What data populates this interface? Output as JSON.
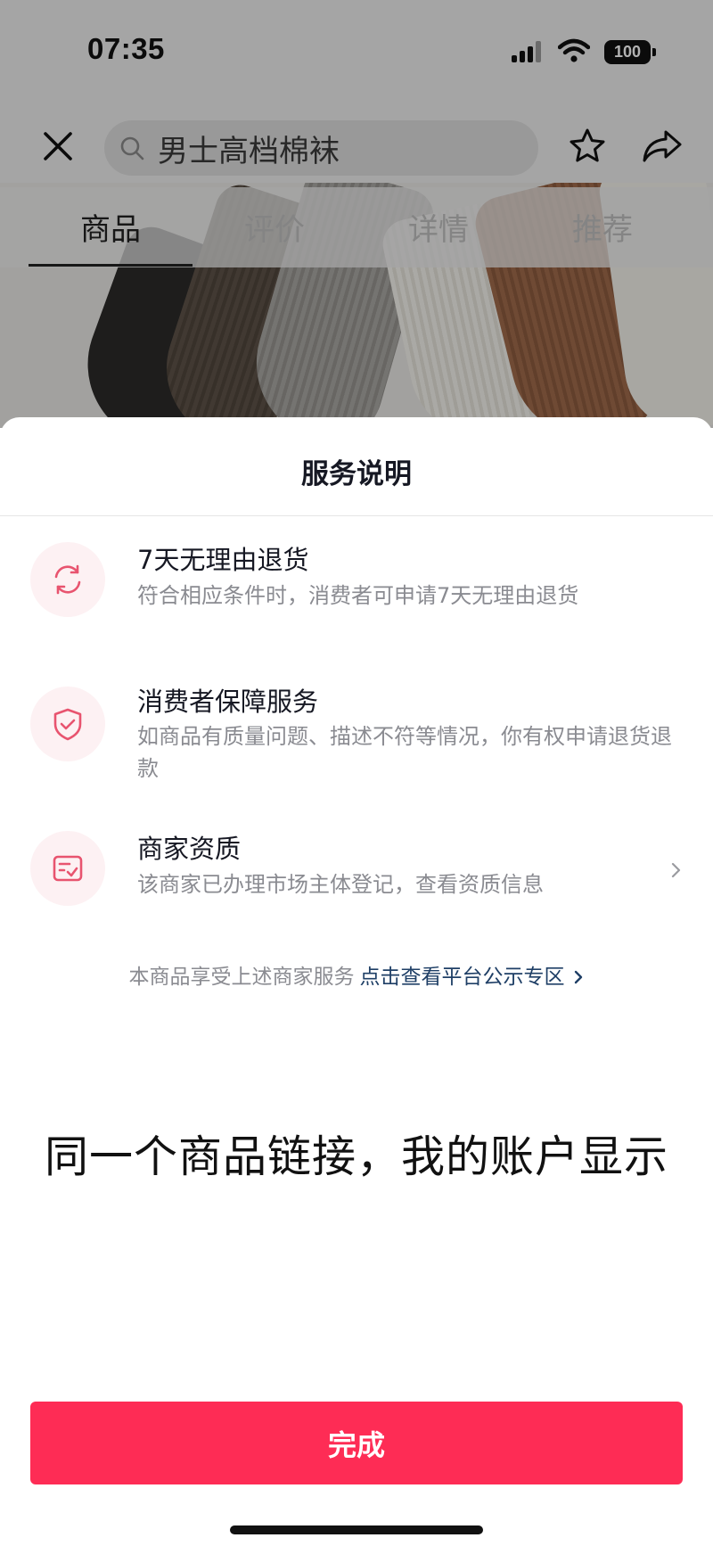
{
  "status_bar": {
    "time": "07:35",
    "battery": "100"
  },
  "top_bar": {
    "search_text": "男士高档棉袜"
  },
  "tabs": [
    {
      "label": "商品",
      "active": true
    },
    {
      "label": "评价",
      "active": false
    },
    {
      "label": "详情",
      "active": false
    },
    {
      "label": "推荐",
      "active": false
    }
  ],
  "sheet": {
    "title": "服务说明",
    "services": [
      {
        "icon": "return-refresh-icon",
        "title": "7天无理由退货",
        "desc": "符合相应条件时，消费者可申请7天无理由退货"
      },
      {
        "icon": "shield-check-icon",
        "title": "消费者保障服务",
        "desc": "如商品有质量问题、描述不符等情况，你有权申请退货退款"
      },
      {
        "icon": "certificate-icon",
        "title": "商家资质",
        "desc": "该商家已办理市场主体登记，查看资质信息"
      }
    ],
    "footer_text": "本商品享受上述商家服务",
    "footer_link": "点击查看平台公示专区",
    "caption": "同一个商品链接，我的账户显示",
    "done_label": "完成"
  },
  "colors": {
    "accent": "#fe2c55",
    "link": "#1f3f66",
    "icon_pink": "#e8546f"
  }
}
